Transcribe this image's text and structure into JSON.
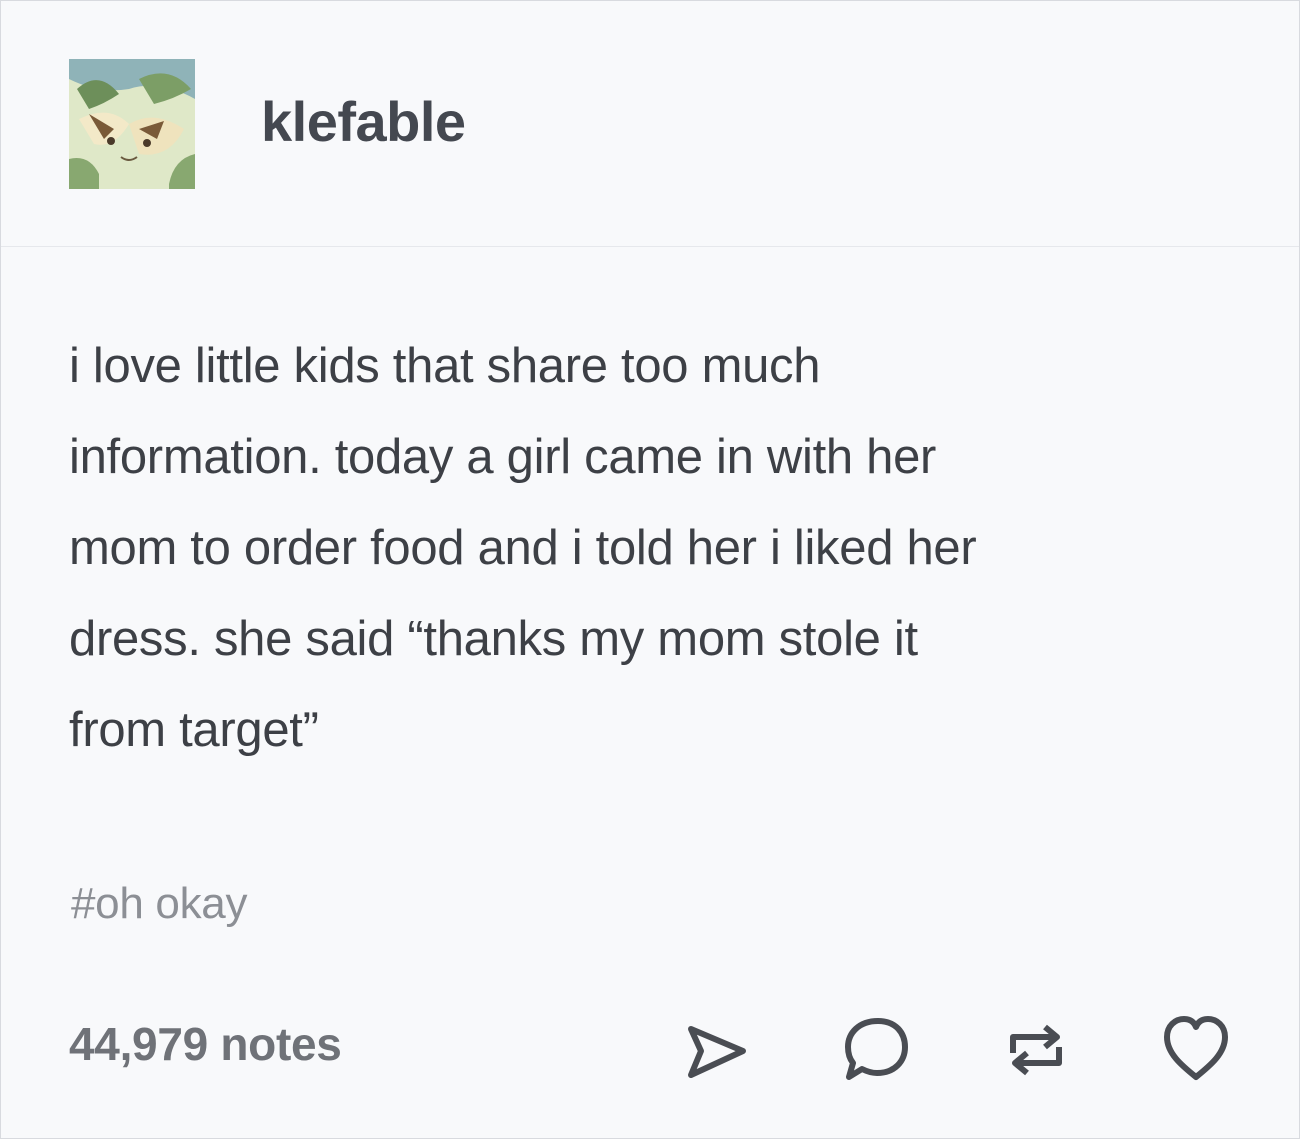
{
  "post": {
    "username": "klefable",
    "body_lines": [
      "i love little kids that share too much",
      "information. today a girl came in with her",
      "mom to order food and i told her i liked her",
      "dress. she said “thanks my mom stole it",
      "from target”"
    ],
    "tags": "#oh okay",
    "notes": "44,979 notes"
  },
  "actions": [
    {
      "name": "share",
      "icon": "send-icon"
    },
    {
      "name": "reply",
      "icon": "speech-bubble-icon"
    },
    {
      "name": "reblog",
      "icon": "reblog-icon"
    },
    {
      "name": "like",
      "icon": "heart-icon"
    }
  ],
  "colors": {
    "background": "#f8f9fb",
    "text": "#3d4046",
    "tag_text": "#8c8f95",
    "notes_text": "#6f7278",
    "icon_stroke": "#4a4d53"
  }
}
